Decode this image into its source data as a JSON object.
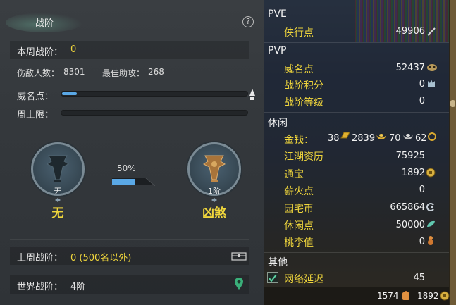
{
  "left": {
    "title": "战阶",
    "help_label": "?",
    "weekly_rank_label": "本周战阶：",
    "weekly_rank_value": "0",
    "kills_label": "伤敌人数：",
    "kills_value": "8301",
    "best_assist_label": "最佳助攻：",
    "best_assist_value": "268",
    "prestige_label": "威名点：",
    "prestige_progress": 0.08,
    "weekly_cap_label": "周上限：",
    "weekly_cap_progress": 0.0,
    "current_medal_caption": "无",
    "current_rank_name": "无",
    "progress_percent_text": "50%",
    "progress_fraction": 0.5,
    "next_medal_caption": "1阶",
    "next_rank_name": "凶煞",
    "last_week_label": "上周战阶：",
    "last_week_value": "0 (500名以外)",
    "world_rank_label": "世界战阶：",
    "world_rank_value": "4阶",
    "colors": {
      "accent_yellow": "#f0d63c",
      "bar_blue": "#5aa8e6"
    }
  },
  "right": {
    "pve_header": "PVE",
    "pve_items": [
      {
        "label": "侠行点",
        "value": "49906",
        "icon": "feather-icon"
      }
    ],
    "pvp_header": "PVP",
    "pvp_items": [
      {
        "label": "威名点",
        "value": "52437",
        "icon": "mask-icon"
      },
      {
        "label": "战阶积分",
        "value": "0",
        "icon": "crown-icon"
      },
      {
        "label": "战阶等级",
        "value": "0",
        "icon": ""
      }
    ],
    "leisure_header": "休闲",
    "money_label": "金钱：",
    "money": {
      "gold": "38",
      "silver": "2839",
      "copper": "70",
      "iron": "62"
    },
    "leisure_items": [
      {
        "label": "江湖资历",
        "value": "75925",
        "icon": ""
      },
      {
        "label": "通宝",
        "value": "1892",
        "icon": "coin-icon"
      },
      {
        "label": "薪火点",
        "value": "0",
        "icon": ""
      },
      {
        "label": "园宅币",
        "value": "665864",
        "icon": "swirl-icon"
      },
      {
        "label": "休闲点",
        "value": "50000",
        "icon": "leaf-icon"
      },
      {
        "label": "桃李值",
        "value": "0",
        "icon": "gourd-icon"
      }
    ],
    "other_header": "其他",
    "latency_label": "网络延迟",
    "latency_value": "45",
    "latency_checked": true,
    "footer_left_value": "1574",
    "footer_right_value": "1892"
  }
}
